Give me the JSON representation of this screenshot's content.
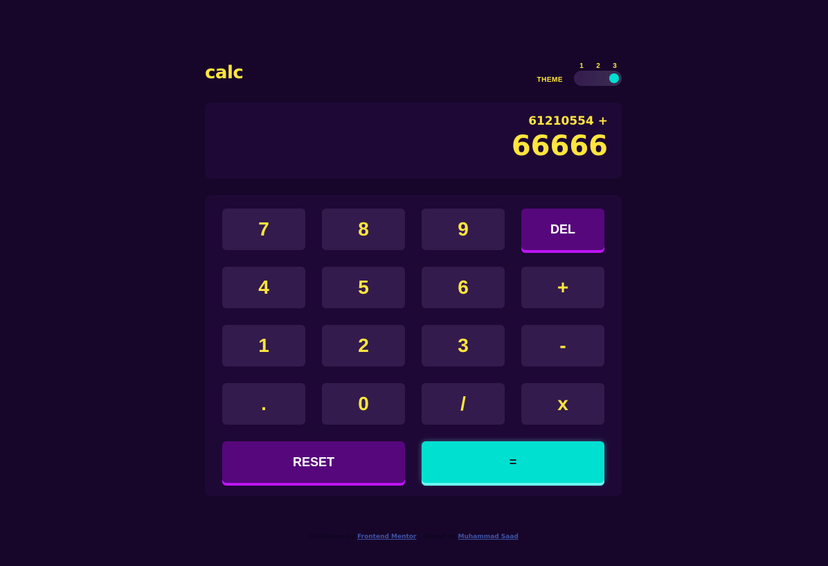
{
  "header": {
    "logo": "calc",
    "theme_label": "THEME",
    "theme_options": [
      "1",
      "2",
      "3"
    ],
    "active_theme": 3
  },
  "screen": {
    "expression": "61210554 +",
    "current": "66666"
  },
  "keys": {
    "k7": "7",
    "k8": "8",
    "k9": "9",
    "del": "DEL",
    "k4": "4",
    "k5": "5",
    "k6": "6",
    "plus": "+",
    "k1": "1",
    "k2": "2",
    "k3": "3",
    "minus": "-",
    "dot": ".",
    "k0": "0",
    "divide": "/",
    "multiply": "x",
    "reset": "RESET",
    "equals": "="
  },
  "footer": {
    "challenge_prefix": "Challenge by",
    "challenge_link": "Frontend Mentor",
    "coded_prefix": ". Coded by",
    "coded_link": "Muhammad Saad"
  },
  "colors": {
    "background": "#17062a",
    "panel": "#1e0836",
    "key": "#331b4d",
    "accent_text": "#ffe53d",
    "del_reset": "#56077c",
    "equals": "#00e0d1"
  }
}
